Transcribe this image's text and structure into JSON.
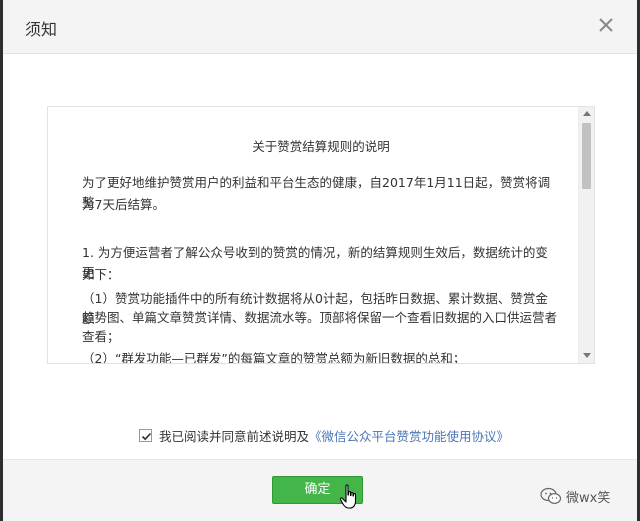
{
  "dialog": {
    "title": "须知",
    "close_icon": "close-icon"
  },
  "content": {
    "doc_title": "关于赞赏结算规则的说明",
    "intro_line1": "为了更好地维护赞赏用户的利益和平台生态的健康，自2017年1月11日起，赞赏将调整",
    "intro_line2": "为7天后结算。",
    "item1_line1": "1. 为方便运营者了解公众号收到的赞赏的情况，新的结算规则生效后，数据统计的变更",
    "item1_line2": "如下：",
    "sub1_line1": "（1）赞赏功能插件中的所有统计数据将从0计起，包括昨日数据、累计数据、赞赏金额",
    "sub1_line2": "趋势图、单篇文章赞赏详情、数据流水等。顶部将保留一个查看旧数据的入口供运营者",
    "sub1_line3": "查看；",
    "sub2_line1": "（2）“群发功能—已群发”的每篇文章的赞赏总额为新旧数据的总和；"
  },
  "agreement": {
    "checked": true,
    "text": "我已阅读并同意前述说明及",
    "link": "《微信公众平台赞赏功能使用协议》"
  },
  "footer": {
    "confirm_label": "确定"
  },
  "watermark": {
    "text": "微wx笑",
    "icon": "wechat-logo-icon"
  },
  "colors": {
    "confirm_green": "#44b549",
    "link_blue": "#4b74b5"
  }
}
